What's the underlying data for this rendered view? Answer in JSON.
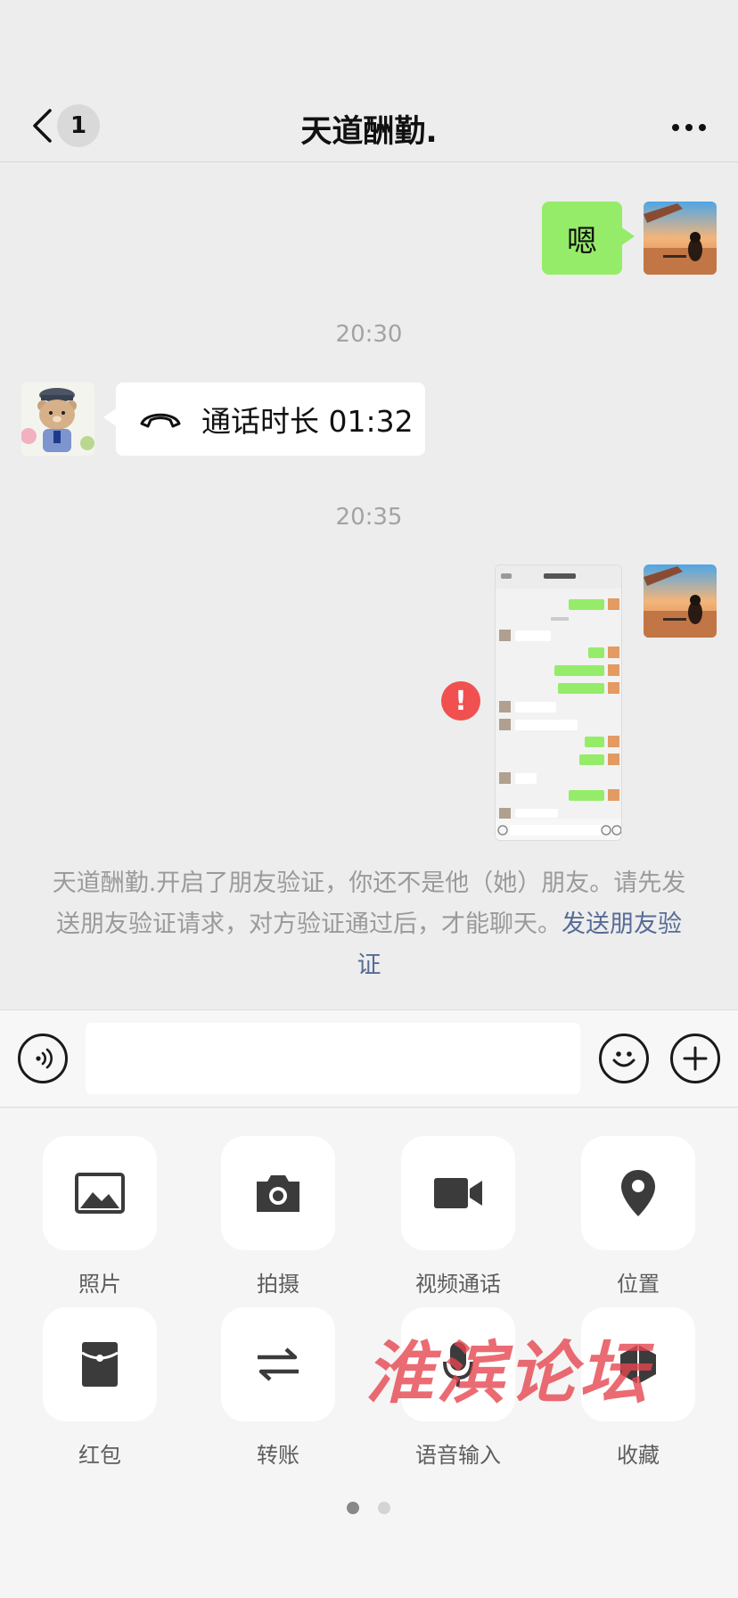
{
  "header": {
    "title": "天道酬勤.",
    "unread_count": "1"
  },
  "messages": {
    "m1_text": "嗯",
    "time1": "20:30",
    "call_text": "通话时长 01:32",
    "time2": "20:35",
    "error_mark": "!"
  },
  "notice": {
    "text": "天道酬勤.开启了朋友验证，你还不是他（她）朋友。请先发送朋友验证请求，对方验证通过后，才能聊天。",
    "link": "发送朋友验证"
  },
  "input": {
    "placeholder": ""
  },
  "panel": {
    "items": [
      {
        "label": "照片",
        "icon": "photo-icon"
      },
      {
        "label": "拍摄",
        "icon": "camera-icon"
      },
      {
        "label": "视频通话",
        "icon": "video-call-icon"
      },
      {
        "label": "位置",
        "icon": "location-icon"
      },
      {
        "label": "红包",
        "icon": "red-packet-icon"
      },
      {
        "label": "转账",
        "icon": "transfer-icon"
      },
      {
        "label": "语音输入",
        "icon": "voice-input-icon"
      },
      {
        "label": "收藏",
        "icon": "favorites-icon"
      }
    ],
    "page_count": 2,
    "current_page": 1
  },
  "watermark": "淮滨论坛",
  "colors": {
    "bubble_me": "#95ec69",
    "link": "#576b95",
    "error": "#f05050",
    "background": "#ededed"
  }
}
